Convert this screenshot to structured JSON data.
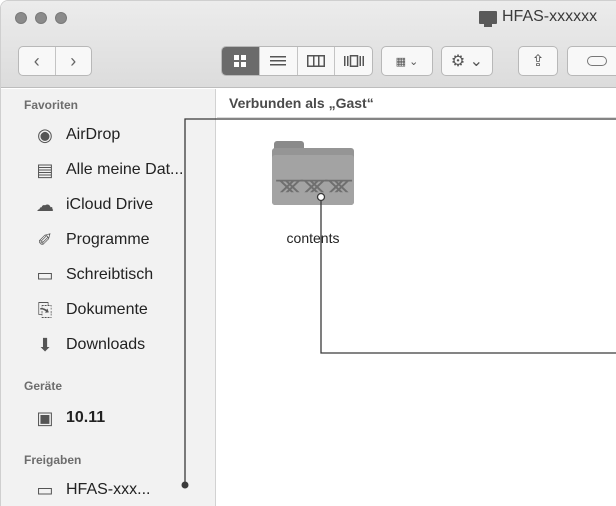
{
  "window": {
    "title": "HFAS-xxxxxx"
  },
  "toolbar": {
    "back_glyph": "‹",
    "forward_glyph": "›",
    "view_icons": [
      "icon-view-icon",
      "list-view-icon",
      "column-view-icon",
      "cover-flow-icon"
    ],
    "arrange_glyph": "▦ ⌄",
    "action_glyph": "⚙ ⌄",
    "share_glyph": "⇪"
  },
  "sidebar": {
    "favorites_heading": "Favoriten",
    "favorites": [
      {
        "label": "AirDrop",
        "icon": "airdrop-icon",
        "glyph": "◉"
      },
      {
        "label": "Alle meine Dat...",
        "icon": "all-files-icon",
        "glyph": "▤"
      },
      {
        "label": "iCloud Drive",
        "icon": "cloud-icon",
        "glyph": "☁"
      },
      {
        "label": "Programme",
        "icon": "applications-icon",
        "glyph": "✐"
      },
      {
        "label": "Schreibtisch",
        "icon": "desktop-icon",
        "glyph": "▭"
      },
      {
        "label": "Dokumente",
        "icon": "documents-icon",
        "glyph": "⎘"
      },
      {
        "label": "Downloads",
        "icon": "downloads-icon",
        "glyph": "⬇"
      }
    ],
    "devices_heading": "Geräte",
    "devices": [
      {
        "label": "10.11",
        "icon": "disk-icon",
        "glyph": "▣"
      }
    ],
    "shared_heading": "Freigaben",
    "shared": [
      {
        "label": "HFAS-xxx...",
        "icon": "server-icon",
        "glyph": "▭"
      }
    ]
  },
  "content": {
    "status_path": "Verbunden als „Gast“",
    "items": [
      {
        "label": "contents",
        "icon": "shared-folder-icon",
        "glyph": "ᚘᚘᚘ"
      }
    ]
  },
  "colors": {
    "sidebar_bg": "#f2f2f2",
    "active_view": "#6b6b6b",
    "folder": "#a3a3a3"
  }
}
